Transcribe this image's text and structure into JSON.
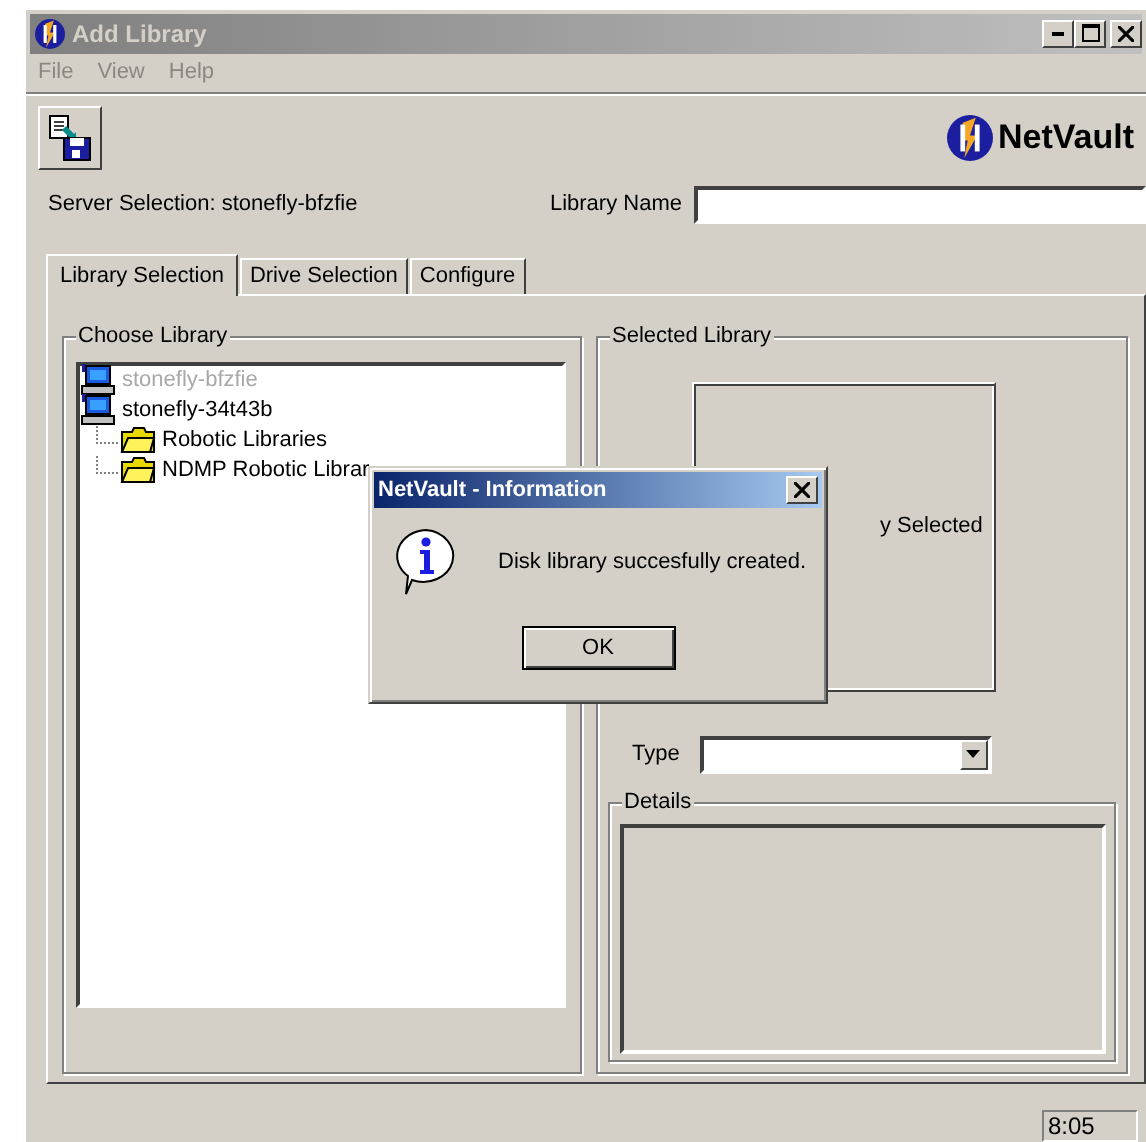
{
  "window": {
    "title": "Add Library"
  },
  "menu": [
    {
      "label": "File",
      "disabled": true
    },
    {
      "label": "View",
      "disabled": true
    },
    {
      "label": "Help",
      "disabled": true
    }
  ],
  "logo": {
    "text": "NetVault"
  },
  "server_selection": "Server Selection: stonefly-bfzfie",
  "library_name": {
    "label": "Library Name"
  },
  "tabs": [
    {
      "label": "Library Selection",
      "selected": true
    },
    {
      "label": "Drive Selection",
      "selected": false
    },
    {
      "label": "Configure",
      "selected": false
    }
  ],
  "choose_library": {
    "title": "Choose Library",
    "tree": [
      {
        "label": "stonefly-bfzfie",
        "kind": "server",
        "disabled": true
      },
      {
        "label": "stonefly-34t43b",
        "kind": "server",
        "disabled": false,
        "children": [
          {
            "label": "Robotic Libraries",
            "kind": "folder",
            "disabled": false
          },
          {
            "label": "NDMP Robotic Librar",
            "kind": "folder",
            "disabled": false
          }
        ]
      }
    ]
  },
  "selected_library": {
    "title": "Selected Library",
    "message": "y Selected",
    "type_label": "Type",
    "details_title": "Details"
  },
  "status_bar": {
    "clock": "8:05"
  },
  "dialog": {
    "title": "NetVault - Information",
    "message": "Disk library succesfully created.",
    "button": "OK"
  }
}
